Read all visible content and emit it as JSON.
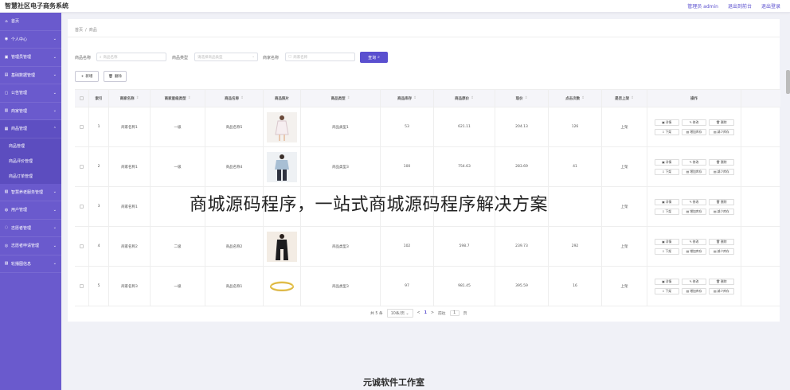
{
  "app": {
    "title": "智慧社区电子商务系统"
  },
  "top_links": [
    {
      "label": "管理员 admin"
    },
    {
      "label": "退出到前台"
    },
    {
      "label": "退出登录"
    }
  ],
  "sidebar": {
    "items": [
      {
        "label": "首页",
        "icon": "home-icon",
        "glyph": "⌂",
        "chev": ""
      },
      {
        "label": "个人中心",
        "icon": "user-icon",
        "glyph": "◉",
        "chev": "⌄"
      },
      {
        "label": "管理员管理",
        "icon": "admin-icon",
        "glyph": "▣",
        "chev": "⌄"
      },
      {
        "label": "基础数据管理",
        "icon": "data-icon",
        "glyph": "▤",
        "chev": "⌄"
      },
      {
        "label": "公告管理",
        "icon": "notice-icon",
        "glyph": "▢",
        "chev": "⌄"
      },
      {
        "label": "商家管理",
        "icon": "shop-icon",
        "glyph": "▥",
        "chev": "⌄"
      },
      {
        "label": "商品管理",
        "icon": "goods-icon",
        "glyph": "▦",
        "chev": "⌃"
      }
    ],
    "sub_items": [
      {
        "label": "商品管理"
      },
      {
        "label": "商品评价管理"
      },
      {
        "label": "商品订单管理"
      }
    ],
    "items_after": [
      {
        "label": "智慧养老服务管理",
        "icon": "service-icon",
        "glyph": "▧",
        "chev": "⌄"
      },
      {
        "label": "用户管理",
        "icon": "users-icon",
        "glyph": "◍",
        "chev": "⌄"
      },
      {
        "label": "志愿者管理",
        "icon": "volunteer-icon",
        "glyph": "◌",
        "chev": "⌄"
      },
      {
        "label": "志愿者申请管理",
        "icon": "apply-icon",
        "glyph": "◎",
        "chev": "⌄"
      },
      {
        "label": "轮播图信息",
        "icon": "banner-icon",
        "glyph": "▨",
        "chev": "⌄"
      }
    ]
  },
  "breadcrumb": {
    "home": "首页",
    "sep": "/",
    "current": "商品"
  },
  "filters": [
    {
      "label": "商品名称",
      "placeholder": "商品名称"
    },
    {
      "label": "商品类型",
      "placeholder": "请选择商品类型"
    },
    {
      "label": "商家名称",
      "placeholder": "商家名称"
    }
  ],
  "search_button": "查询",
  "actions": {
    "add": "新增",
    "delete": "删除"
  },
  "table": {
    "headers": [
      "索引",
      "商家名称",
      "商家星级类型",
      "商品名称",
      "商品照片",
      "商品类型",
      "商品库存",
      "商品原价",
      "现价",
      "点击次数",
      "是否上架",
      "操作"
    ],
    "rows": [
      {
        "index": "1",
        "shop": "商家名称1",
        "level": "一级",
        "name": "商品名称5",
        "type": "商品类型1",
        "stock": "53",
        "price": "621.11",
        "now": "204.13",
        "clicks": "126",
        "status": "上架",
        "img": "dress"
      },
      {
        "index": "2",
        "shop": "商家名称1",
        "level": "一级",
        "name": "商品名称4",
        "type": "商品类型3",
        "stock": "100",
        "price": "754.63",
        "now": "283.69",
        "clicks": "41",
        "status": "上架",
        "img": "shirt"
      },
      {
        "index": "3",
        "shop": "商家名称1",
        "level": "",
        "name": "",
        "type": "",
        "stock": "",
        "price": "",
        "now": "",
        "clicks": "",
        "status": "上架",
        "img": "none"
      },
      {
        "index": "4",
        "shop": "商家名称2",
        "level": "二级",
        "name": "商品名称2",
        "type": "商品类型3",
        "stock": "102",
        "price": "598.7",
        "now": "239.73",
        "clicks": "292",
        "status": "上架",
        "img": "suit"
      },
      {
        "index": "5",
        "shop": "商家名称3",
        "level": "一级",
        "name": "商品名称1",
        "type": "商品类型3",
        "stock": "97",
        "price": "981.45",
        "now": "395.59",
        "clicks": "16",
        "status": "上架",
        "img": "ring"
      }
    ],
    "ops": [
      "详情",
      "修改",
      "删除",
      "下架",
      "增加库存",
      "减少库存"
    ]
  },
  "pagination": {
    "total": "共 5 条",
    "size": "10条/页",
    "prev": "<",
    "page": "1",
    "next": ">",
    "goto": "前往",
    "goto_val": "1",
    "page_unit": "页"
  },
  "overlay": {
    "text": "商城源码程序，一站式商城源码程序解决方案"
  },
  "footer": {
    "studio": "元诚软件工作室"
  },
  "colors": {
    "accent": "#5a4fcf",
    "sidebar": "#6a5acd"
  }
}
